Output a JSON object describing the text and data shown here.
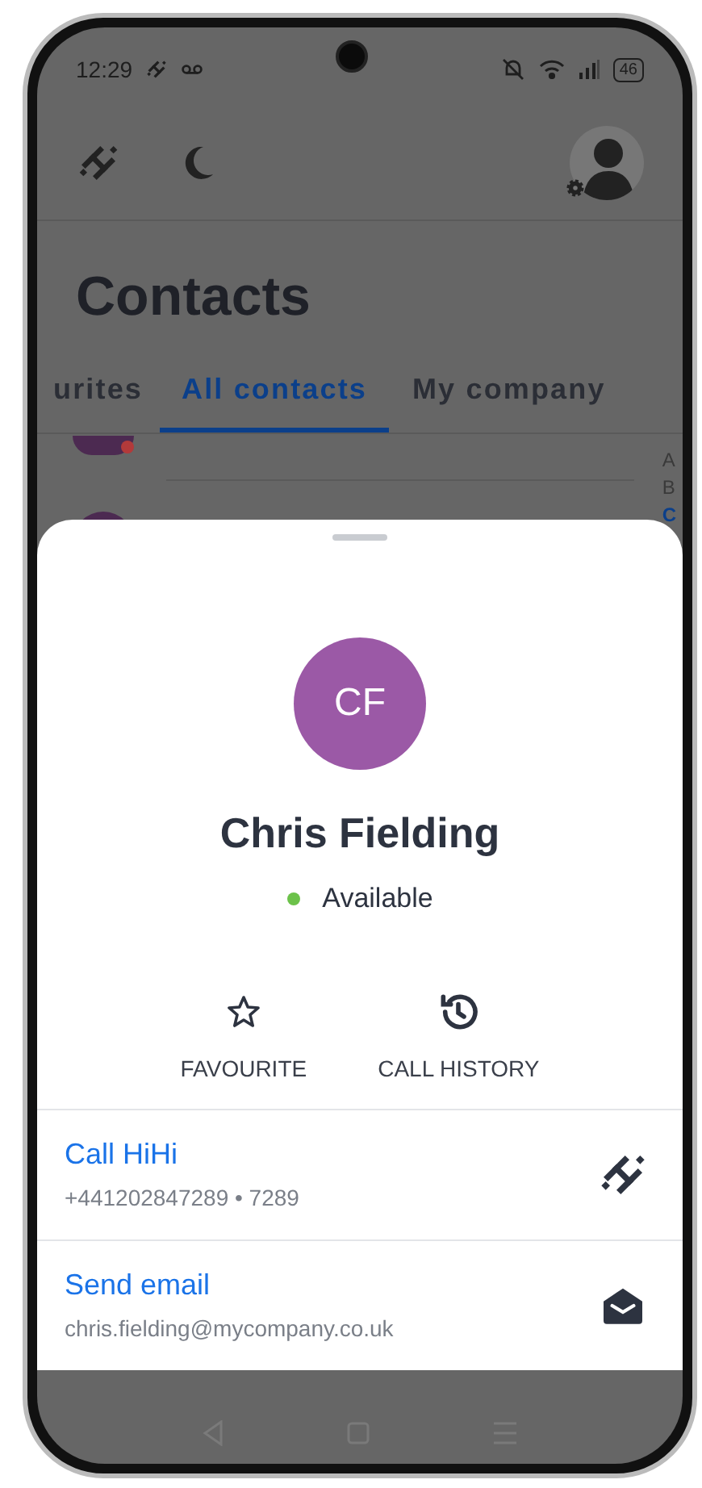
{
  "status_bar": {
    "time": "12:29",
    "battery": "46"
  },
  "title": "Contacts",
  "tabs": [
    {
      "label": "urites",
      "selected": false
    },
    {
      "label": "All contacts",
      "selected": true
    },
    {
      "label": "My company",
      "selected": false
    }
  ],
  "alphabet_index": [
    {
      "letter": "A",
      "selected": false
    },
    {
      "letter": "B",
      "selected": false
    },
    {
      "letter": "C",
      "selected": true
    }
  ],
  "contact_sheet": {
    "initials": "CF",
    "name": "Chris Fielding",
    "presence": {
      "available": true,
      "label": "Available"
    },
    "actions": [
      {
        "kind": "favourite",
        "label": "FAVOURITE"
      },
      {
        "kind": "history",
        "label": "CALL HISTORY"
      }
    ],
    "methods": [
      {
        "kind": "call",
        "title": "Call HiHi",
        "detail": "+441202847289 • 7289"
      },
      {
        "kind": "email",
        "title": "Send email",
        "detail": "chris.fielding@mycompany.co.uk"
      }
    ]
  }
}
